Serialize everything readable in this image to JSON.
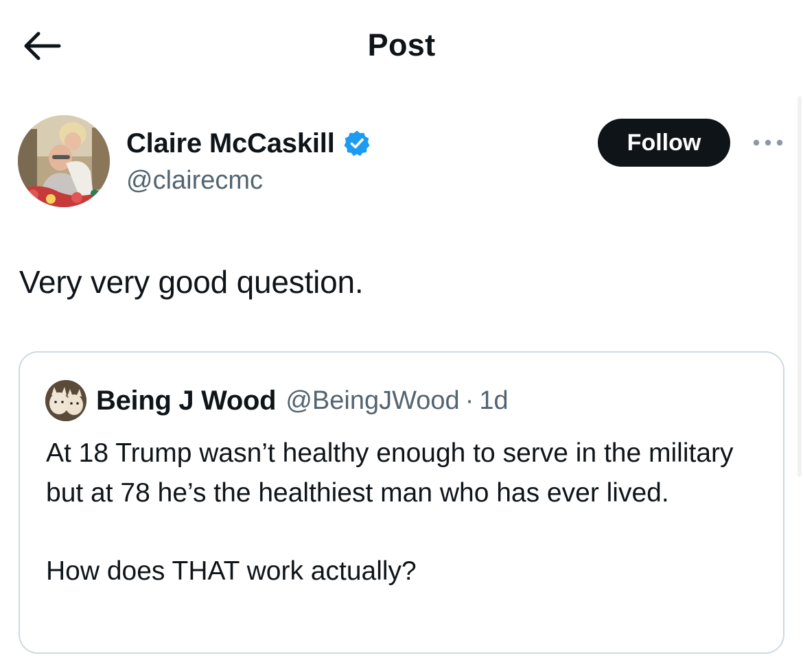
{
  "header": {
    "title": "Post"
  },
  "post": {
    "author": {
      "display_name": "Claire McCaskill",
      "handle": "@clairecmc",
      "verified": true
    },
    "follow_label": "Follow",
    "text": "Very very good question."
  },
  "quoted_post": {
    "author": {
      "display_name": "Being J Wood",
      "handle": "@BeingJWood",
      "separator": "·",
      "time": "1d"
    },
    "text_lines": [
      "At 18 Trump wasn’t healthy enough to serve in the military but at 78 he’s the healthiest man who has ever lived.",
      "How does THAT work actually?"
    ]
  },
  "icons": {
    "back": "arrow-left-icon",
    "verified": "verified-badge-icon",
    "more": "more-horizontal-icon"
  },
  "colors": {
    "verified_blue": "#1d9bf0",
    "follow_bg": "#0f1419",
    "secondary_text": "#536471",
    "card_border": "#cfd9de"
  }
}
